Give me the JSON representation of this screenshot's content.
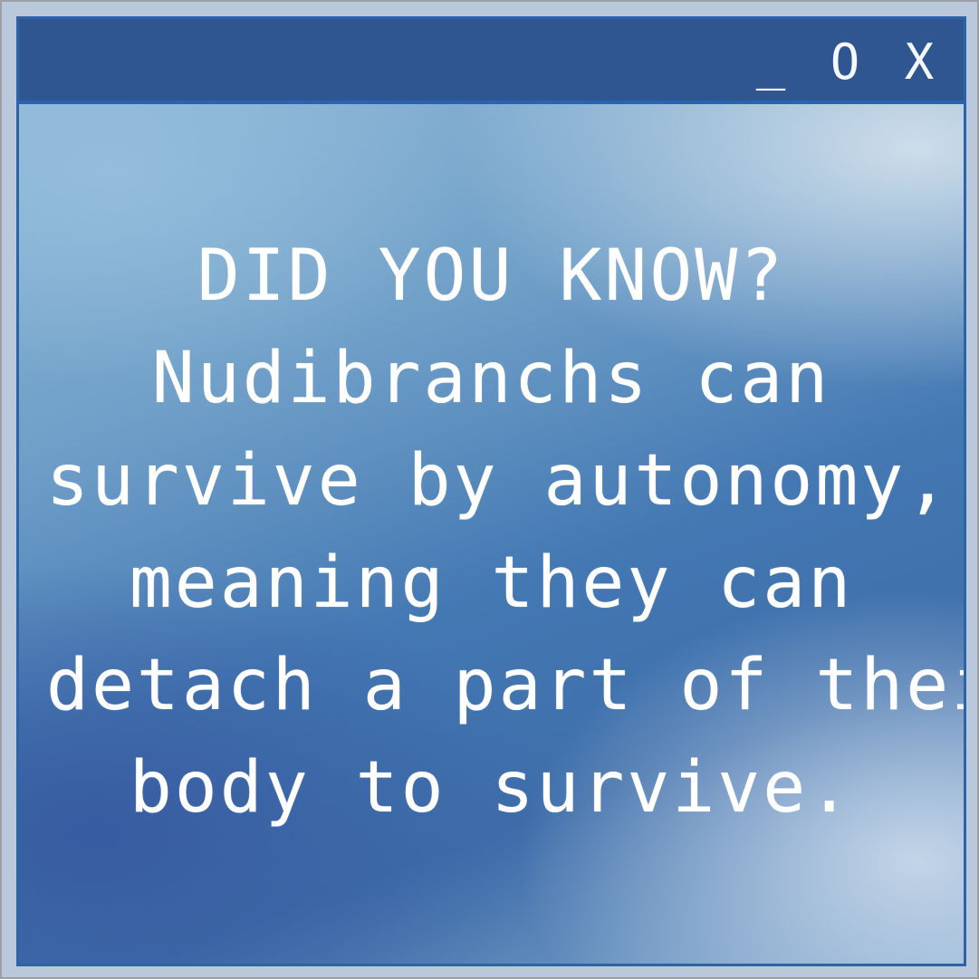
{
  "window": {
    "controls": {
      "minimize_label": "_",
      "maximize_label": "O",
      "close_label": "X"
    }
  },
  "message": {
    "lines": [
      "DID YOU KNOW?",
      "Nudibranchs can",
      "survive by autonomy,",
      "meaning they can",
      "detach a part of their",
      "body to survive."
    ]
  },
  "colors": {
    "titlebar": "#2f5690",
    "border": "#2a63b0",
    "text": "#ffffff"
  }
}
